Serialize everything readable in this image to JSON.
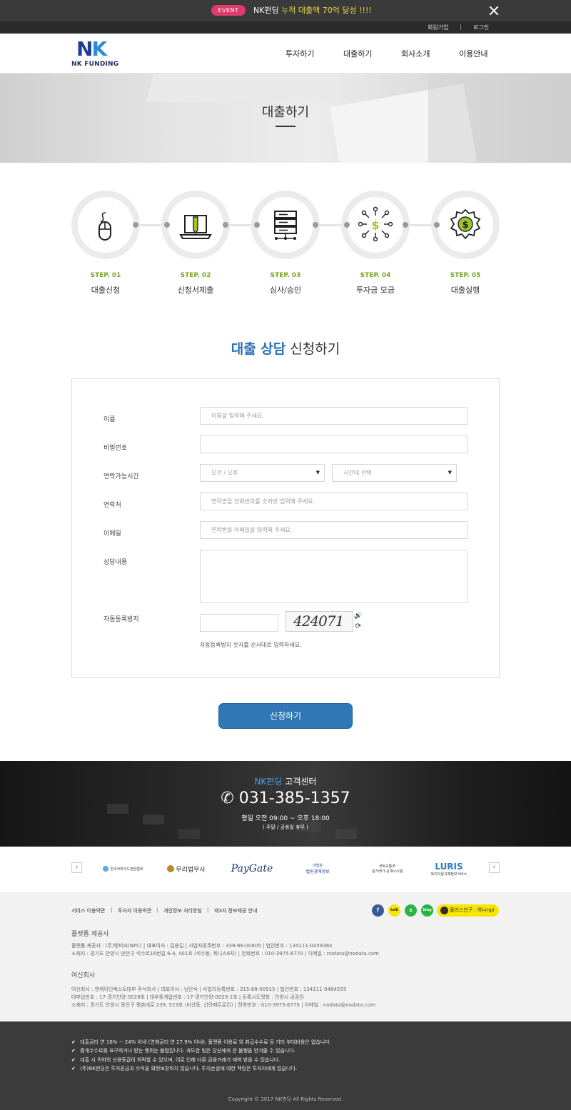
{
  "event": {
    "badge": "EVENT",
    "text_prefix": "NK펀딩 ",
    "text_highlight": "누적 대출액",
    "text_amount": " 70억 달성 !!!!"
  },
  "util": {
    "join": "회원가입",
    "separator": "|",
    "login": "로그인"
  },
  "header": {
    "logo_mark_n": "N",
    "logo_mark_k": "K",
    "logo_text": "NK FUNDING",
    "nav": [
      "투자하기",
      "대출하기",
      "회사소개",
      "이용안내"
    ]
  },
  "hero": {
    "title": "대출하기"
  },
  "steps": [
    {
      "num": "STEP. 01",
      "label": "대출신청",
      "icon": "mouse-icon"
    },
    {
      "num": "STEP. 02",
      "label": "신청서제출",
      "icon": "laptop-pencil-icon"
    },
    {
      "num": "STEP. 03",
      "label": "심사/승인",
      "icon": "server-icon"
    },
    {
      "num": "STEP. 04",
      "label": "투자금 모금",
      "icon": "money-network-icon"
    },
    {
      "num": "STEP. 05",
      "label": "대출실행",
      "icon": "dollar-badge-icon"
    }
  ],
  "form": {
    "title_bold": "대출 상담",
    "title_rest": " 신청하기",
    "labels": {
      "name": "이름",
      "password": "비밀번호",
      "contact_time": "연락가능시간",
      "phone": "연락처",
      "email": "이메일",
      "content": "상담내용",
      "captcha": "자동등록방지"
    },
    "placeholders": {
      "name": "이름을 입력해 주세요.",
      "phone": "연락받을 전화번호를 숫자만 입력해 주세요.",
      "email": "연락받을 이메일을 입력해 주세요."
    },
    "selects": {
      "ampm": "오전 / 오후",
      "time": "시간대 선택"
    },
    "captcha_value": "424071",
    "captcha_help": "자동등록방지 숫자를 순서대로 입력하세요.",
    "submit": "신청하기"
  },
  "customer_center": {
    "title_blue": "NK펀딩",
    "title_rest": " 고객센터",
    "phone": "031-385-1357",
    "hours": "평일 오전 09:00 ~ 오후 18:00",
    "holiday": "( 주말 / 공휴일 휴무 )"
  },
  "partners": {
    "prev": "‹",
    "next": "›",
    "logos": [
      "한국크라우드펀딩협회",
      "우리법무사",
      "PayGate",
      "법원경매정보",
      "실거래가 공개시스템",
      "토지이용규제정보서비스"
    ],
    "logo_sub": {
      "court": "대법원",
      "molit": "국토교통부",
      "luris": "LURIS"
    }
  },
  "footer": {
    "links": [
      "서비스 이용약관",
      "투자자 이용약관",
      "개인정보 처리방침",
      "제3자 정보제공 안내"
    ],
    "link_sep": "|",
    "sns": {
      "facebook": "f",
      "kakaotalk": "talk",
      "kakaostory": "s",
      "blog": "blog",
      "plus_friend": "플러스친구 : 하나npl"
    },
    "platform_heading": "플랫폼 제공사",
    "platform_lines": [
      "플랫폼 제공사 : (주)엔피씨(NPC)  |  대표이사 : 김용길  |  사업자등록번호 : 339-86-00805  |  법인번호 : 134111-0459384",
      "소재지 : 경기도 안양시 만안구 석수로16번길 6-4, 401호 (석수동, 제니스6차)  |  전화번호 : 010-3975-6770  |  이메일 : nodata@nodata.com"
    ],
    "lender_heading": "여신회사",
    "lender_lines": [
      "여신회사 : 엔케이인베스트대부 주식회사  |  대표이사 : 남은숙  |  사업자등록번호 : 315-88-00915  |  법인번호 : 134111-0484555",
      "대부업번호 : 17-경기안양-0029호  |  대부중개업번호 : 17-경기안양-0029-1호  |  등록시도명칭 : 안양시 금감원",
      "소재지 : 경기도 안양시 동안구 평촌대로 239, 523호 (비산동, 신안메트로칸)  |  전화번호 : 010-3975-6770  |  이메일 : nodata@nodata.com"
    ]
  },
  "notice": {
    "lines": [
      "대출금리 연 16% ~ 24% 이내 (연체금리 연 27.9% 이내), 플랫폼 이용료 외 취급수수료 등 기타 부대비용은 없습니다.",
      "중개수수료를 요구하거나 받는 행위는 불법입니다. 과도한 빚은 당신에게 큰 불행을 안겨줄 수 있습니다.",
      "대출 시 귀하의 신용등급이 하락할 수 있으며, 이로 인해 다른 금융거래가 제약 받을 수 있습니다.",
      "(주)NK펀딩은 투자원금과 수익을 확정보장하지 않습니다. 투자손실에 대한 책임은 투자자에게 있습니다."
    ],
    "check": "✔",
    "copyright": "Copyright © 2017 NK펀딩 All Rights Reserved."
  },
  "colors": {
    "event_badge": "#e23a6b",
    "step_green": "#7aa51f",
    "brand_blue": "#2a6fb5",
    "submit_bg": "#2f77b5"
  }
}
